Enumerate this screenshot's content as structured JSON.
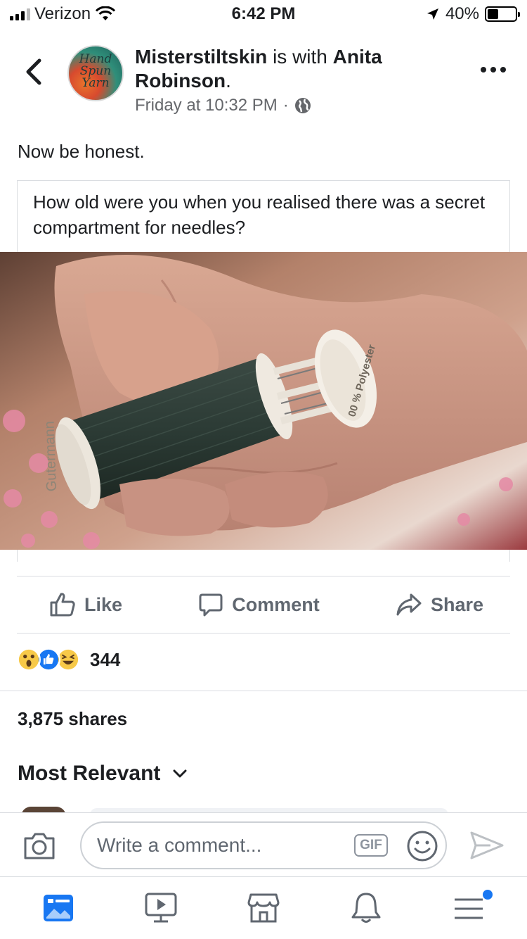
{
  "status_bar": {
    "carrier": "Verizon",
    "time": "6:42 PM",
    "battery": "40%",
    "battery_level": 0.4,
    "icons": [
      "signal-icon",
      "wifi-icon",
      "location-icon",
      "battery-icon"
    ]
  },
  "post": {
    "author": "Misterstiltskin",
    "with_text": "is with",
    "tagged": "Anita Robinson",
    "tagged_suffix": ".",
    "timestamp": "Friday at 10:32 PM",
    "separator": "·",
    "text": "Now be honest.",
    "avatar_text": "Hand Spun Yarn",
    "shared_caption": "How old were you when you realised there was a secret compartment for needles?",
    "photo_text": {
      "spool_brand": "Gutermann",
      "spool_label": "00 % Polyester"
    }
  },
  "actions": {
    "like": "Like",
    "comment": "Comment",
    "share": "Share"
  },
  "reactions": {
    "count": "344",
    "types": [
      "wow-icon",
      "like-icon",
      "haha-icon"
    ]
  },
  "shares": "3,875 shares",
  "comments": {
    "sort_label": "Most Relevant",
    "input_placeholder": "Write a comment...",
    "gif_label": "GIF"
  },
  "tabbar": {
    "items": [
      "news-feed-icon",
      "watch-icon",
      "marketplace-icon",
      "notifications-icon",
      "menu-icon"
    ]
  },
  "colors": {
    "accent": "#1877f2",
    "text": "#1c1e21",
    "secondary_text": "#65676b",
    "divider": "#dadde1"
  }
}
